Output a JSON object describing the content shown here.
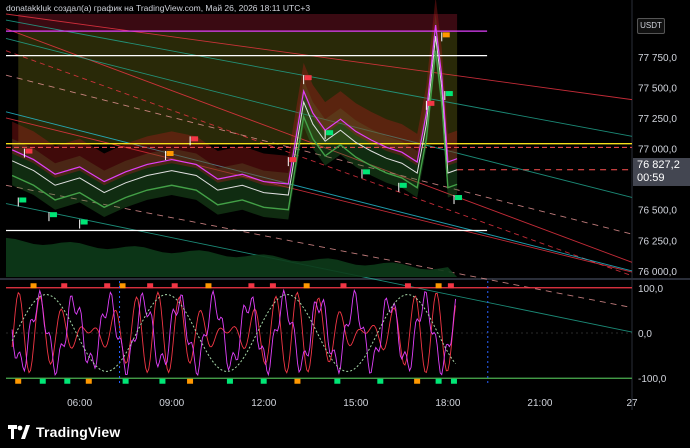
{
  "header": {
    "text": "donatakkluk создал(а) график на TradingView.com, Май 26, 2026 18:11 UTC+3"
  },
  "currency": "USDT",
  "price_tag": {
    "price": "76 827,2",
    "timer": "00:59"
  },
  "footer": {
    "logo_text": "TradingView"
  },
  "colors": {
    "background": "#000000",
    "magenta": "#e040fb",
    "yellow": "#f7e11a",
    "red": "#f23645",
    "green": "#22ab94",
    "orange": "#ff9800"
  },
  "chart_data": [
    {
      "type": "line",
      "panel": "price",
      "y_ticks": [
        "77 750,0",
        "77 500,0",
        "77 250,0",
        "77 000,0",
        "76 500,0",
        "76 250,0",
        "76 000,0"
      ],
      "y_tick_values": [
        77750,
        77500,
        77250,
        77000,
        76500,
        76250,
        76000
      ],
      "ylim": [
        75950,
        78100
      ],
      "x_ticks": [
        "06:00",
        "09:00",
        "12:00",
        "15:00",
        "18:00",
        "21:00",
        "27"
      ],
      "x_tick_hours": [
        6,
        9,
        12,
        15,
        18,
        21,
        24
      ],
      "xlim_hours": [
        3.6,
        24.0
      ],
      "last_price": 76827.2,
      "horizontal_levels": [
        {
          "value": 77960,
          "color": "#e040fb"
        },
        {
          "value": 77760,
          "color": "#ffffff"
        },
        {
          "value": 77040,
          "color": "#f7e11a"
        },
        {
          "value": 77010,
          "color": "#ff5252"
        },
        {
          "value": 76330,
          "color": "#ffffff"
        }
      ],
      "close_series": {
        "x": [
          3.8,
          4.5,
          5.2,
          6.0,
          6.8,
          7.5,
          8.2,
          9.0,
          9.8,
          10.5,
          11.3,
          12.0,
          12.8,
          13.3,
          13.6,
          14.0,
          14.5,
          15.0,
          15.5,
          16.0,
          16.5,
          17.0,
          17.3,
          17.6,
          17.8,
          18.0,
          18.3
        ],
        "y": [
          76900,
          76820,
          76700,
          76760,
          76640,
          76720,
          76780,
          76820,
          76780,
          76660,
          76700,
          76640,
          76620,
          77380,
          77200,
          77060,
          77150,
          77050,
          76980,
          76920,
          76880,
          76800,
          77200,
          77920,
          77500,
          76800,
          76827
        ]
      }
    },
    {
      "type": "line",
      "panel": "oscillator",
      "y_ticks": [
        "100,0",
        "0,0",
        "-100,0"
      ],
      "y_tick_values": [
        100,
        0,
        -100
      ],
      "ylim": [
        -115,
        115
      ],
      "x_ticks": [
        "06:00",
        "09:00",
        "12:00",
        "15:00",
        "18:00",
        "21:00",
        "27"
      ]
    }
  ]
}
